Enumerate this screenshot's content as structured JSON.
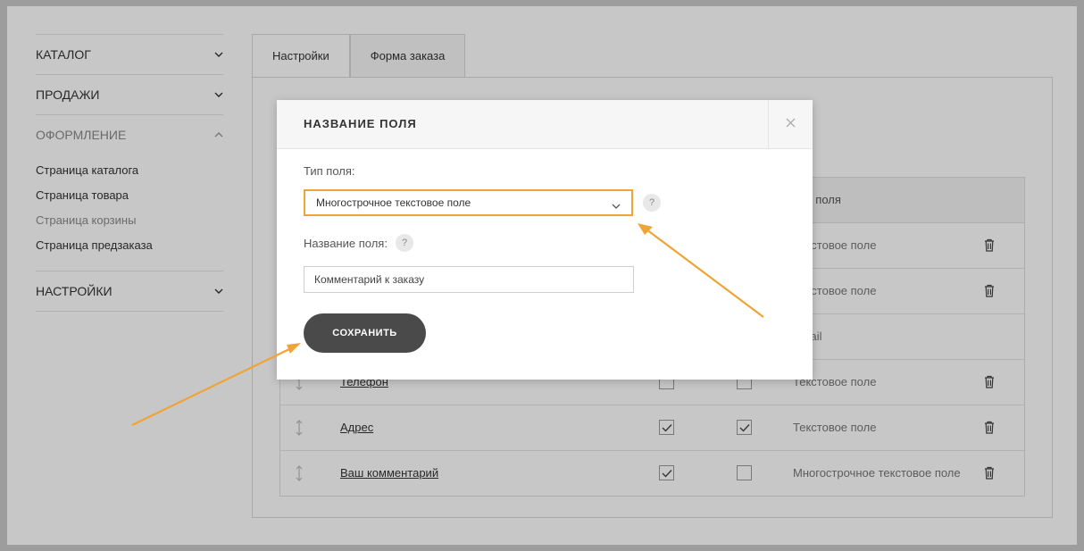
{
  "sidebar": {
    "sections": [
      {
        "label": "КАТАЛОГ"
      },
      {
        "label": "ПРОДАЖИ"
      },
      {
        "label": "ОФОРМЛЕНИЕ"
      },
      {
        "label": "НАСТРОЙКИ"
      }
    ],
    "design_items": [
      {
        "label": "Страница каталога"
      },
      {
        "label": "Страница товара"
      },
      {
        "label": "Страница корзины"
      },
      {
        "label": "Страница предзаказа"
      }
    ]
  },
  "tabs": [
    {
      "label": "Настройки"
    },
    {
      "label": "Форма заказа"
    }
  ],
  "table": {
    "type_header": "Тип поля",
    "rows": [
      {
        "name": "",
        "type": "Текстовое поле",
        "req": false,
        "show": false
      },
      {
        "name": "",
        "type": "Текстовое поле",
        "req": false,
        "show": false
      },
      {
        "name": "",
        "type": "Email",
        "req": false,
        "show": false
      },
      {
        "name": "Телефон",
        "type": "Текстовое поле",
        "req": false,
        "show": false
      },
      {
        "name": "Адрес",
        "type": "Текстовое поле",
        "req": true,
        "show": true
      },
      {
        "name": "Ваш комментарий",
        "type": "Многострочное текстовое поле",
        "req": true,
        "show": false
      }
    ]
  },
  "modal": {
    "title": "НАЗВАНИЕ ПОЛЯ",
    "field_type_label": "Тип поля:",
    "field_type_value": "Многострочное текстовое поле",
    "field_name_label": "Название поля:",
    "field_name_value": "Комментарий к заказу",
    "help_glyph": "?",
    "save_label": "СОХРАНИТЬ"
  },
  "colors": {
    "accent": "#f0a336",
    "button": "#4a4a4a"
  }
}
